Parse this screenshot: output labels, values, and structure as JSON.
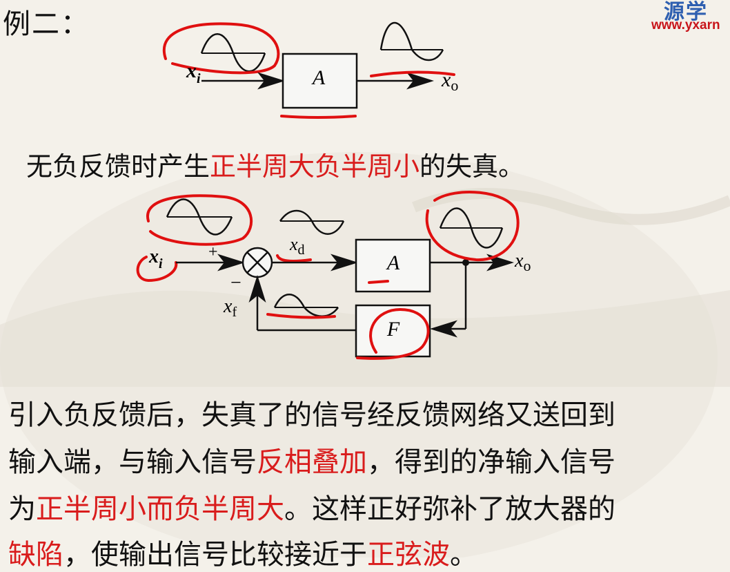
{
  "heading": "例二：",
  "logo": {
    "cn": "源学",
    "url": "www.yxarn"
  },
  "diagram_top": {
    "input_label": "x",
    "input_sub": "i",
    "output_label": "x",
    "output_sub": "o",
    "block": "A"
  },
  "sentence1": {
    "before": "无负反馈时产生",
    "highlight": "正半周大负半周小",
    "after": "的失真。"
  },
  "diagram_bottom": {
    "input_label": "x",
    "input_sub": "i",
    "diff_label": "x",
    "diff_sub": "d",
    "feedback_label": "x",
    "feedback_sub": "f",
    "output_label": "x",
    "output_sub": "o",
    "plus": "+",
    "minus": "−",
    "amp_block": "A",
    "fb_block": "F"
  },
  "paragraph": {
    "line1": "引入负反馈后，失真了的信号经反馈网络又送回到",
    "line2_a": "输入端，与输入信号",
    "line2_hl": "反相叠加",
    "line2_b": "，得到的净输入信号",
    "line3_a": "为",
    "line3_hl": "正半周小而负半周大",
    "line3_b": "。这样正好弥补了放大器的",
    "line4_hl1": "缺陷",
    "line4_a": "，使输出信号比较接近于",
    "line4_hl2": "正弦波",
    "line4_b": "。"
  }
}
